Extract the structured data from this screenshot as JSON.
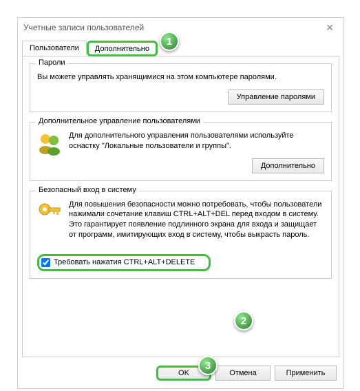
{
  "window": {
    "title": "Учетные записи пользователей"
  },
  "tabs": {
    "t1": "Пользователи",
    "t2": "Дополнительно"
  },
  "groups": {
    "passwords": {
      "legend": "Пароли",
      "desc": "Вы можете управлять хранящимися на этом компьютере паролями.",
      "button": "Управление паролями"
    },
    "advusers": {
      "legend": "Дополнительное управление пользователями",
      "desc": "Для дополнительного управления пользователями используйте оснастку \"Локальные пользователи и группы\".",
      "button": "Дополнительно"
    },
    "secure": {
      "legend": "Безопасный вход в систему",
      "desc": "Для повышения безопасности можно потребовать, чтобы пользователи нажимали сочетание клавиш CTRL+ALT+DEL перед входом в систему. Это гарантирует появление подлинного экрана для входа и защищает от программ, имитирующих вход в систему, чтобы выкрасть пароль.",
      "checkbox": "Требовать нажатия CTRL+ALT+DELETE"
    }
  },
  "footer": {
    "ok": "OK",
    "cancel": "Отмена",
    "apply": "Применить"
  },
  "callouts": {
    "c1": "1",
    "c2": "2",
    "c3": "3"
  }
}
